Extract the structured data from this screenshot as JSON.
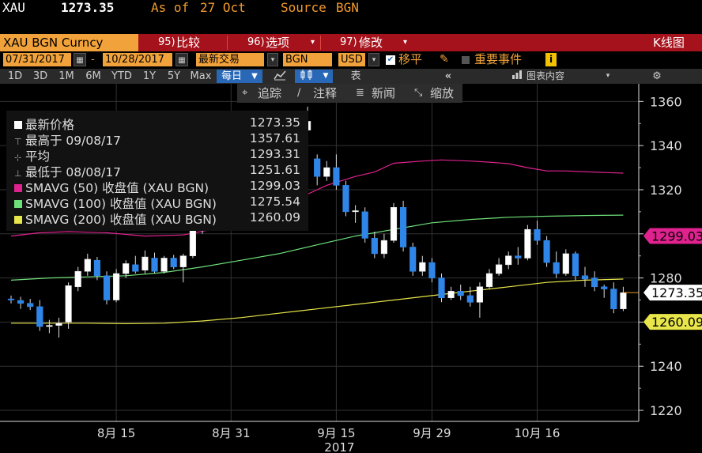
{
  "header": {
    "ticker": "XAU",
    "price": "1273.35",
    "asof_label": "As of",
    "asof_date": "27 Oct",
    "source_label": "Source",
    "source_value": "BGN"
  },
  "toolbar1": {
    "security": "XAU BGN Curncy",
    "compare_num": "95)",
    "compare": "比较",
    "options_num": "96)",
    "options": "选项",
    "edit_num": "97)",
    "edit": "修改",
    "kchart": "K线图"
  },
  "toolbar2": {
    "start_date": "07/31/2017",
    "dash": "-",
    "end_date": "10/28/2017",
    "field": "最新交易",
    "source": "BGN",
    "currency": "USD",
    "move_label": "移平",
    "events_label": "重要事件",
    "info_icon": "i"
  },
  "timeframes": [
    "1D",
    "3D",
    "1M",
    "6M",
    "YTD",
    "1Y",
    "5Y",
    "Max"
  ],
  "toolbar3": {
    "period": "每日",
    "table_label": "表",
    "chart_content": "图表内容"
  },
  "toolbar4": {
    "track": "追踪",
    "annotate": "注释",
    "news": "新闻",
    "zoom": "缩放"
  },
  "legend": {
    "last": {
      "label": "最新价格",
      "value": "1273.35"
    },
    "high": {
      "label": "最高于 09/08/17",
      "value": "1357.61"
    },
    "avg": {
      "label": "平均",
      "value": "1293.31"
    },
    "low": {
      "label": "最低于 08/08/17",
      "value": "1251.61"
    },
    "sma50": {
      "label": "SMAVG (50) 收盘值 (XAU BGN)",
      "value": "1299.03"
    },
    "sma100": {
      "label": "SMAVG (100) 收盘值 (XAU BGN)",
      "value": "1275.54"
    },
    "sma200": {
      "label": "SMAVG (200) 收盘值 (XAU BGN)",
      "value": "1260.09"
    }
  },
  "colors": {
    "up_candle": "#ffffff",
    "down_candle": "#2f86e8",
    "sma50": "#e0228f",
    "sma100": "#6ee07a",
    "sma200": "#e8e64a",
    "last_tag": "#ffffff",
    "toolbar_red": "#a6121b",
    "accent_orange": "#f39a2b"
  },
  "chart_data": {
    "type": "candlestick",
    "ylim": [
      1215,
      1368
    ],
    "yticks": [
      1220,
      1240,
      1260,
      1280,
      1300,
      1320,
      1340,
      1360
    ],
    "xtick_labels": [
      {
        "label": "8月 15",
        "index": 11
      },
      {
        "label": "8月 31",
        "index": 23
      },
      {
        "label": "9月 15",
        "index": 34
      },
      {
        "label": "9月 29",
        "index": 44
      },
      {
        "label": "10月 16",
        "index": 55
      }
    ],
    "year_label": "2017",
    "price_tags": [
      {
        "value": 1299.03,
        "series": "sma50"
      },
      {
        "value": 1273.35,
        "series": "last"
      },
      {
        "value": 1260.09,
        "series": "sma200"
      }
    ],
    "candles": [
      {
        "o": 1270.5,
        "h": 1272.0,
        "l": 1268.5,
        "c": 1270.0
      },
      {
        "o": 1269.8,
        "h": 1271.5,
        "l": 1266.0,
        "c": 1268.5
      },
      {
        "o": 1268.5,
        "h": 1270.5,
        "l": 1265.5,
        "c": 1267.0
      },
      {
        "o": 1267.0,
        "h": 1270.0,
        "l": 1256.0,
        "c": 1258.0
      },
      {
        "o": 1258.0,
        "h": 1261.0,
        "l": 1255.0,
        "c": 1258.5
      },
      {
        "o": 1258.5,
        "h": 1262.0,
        "l": 1253.0,
        "c": 1259.5
      },
      {
        "o": 1260.0,
        "h": 1278.0,
        "l": 1257.0,
        "c": 1276.5
      },
      {
        "o": 1276.0,
        "h": 1285.0,
        "l": 1274.0,
        "c": 1283.0
      },
      {
        "o": 1283.0,
        "h": 1291.0,
        "l": 1281.0,
        "c": 1288.5
      },
      {
        "o": 1288.0,
        "h": 1289.5,
        "l": 1279.0,
        "c": 1281.0
      },
      {
        "o": 1281.0,
        "h": 1283.0,
        "l": 1268.0,
        "c": 1270.0
      },
      {
        "o": 1270.0,
        "h": 1284.0,
        "l": 1269.0,
        "c": 1282.0
      },
      {
        "o": 1282.0,
        "h": 1288.0,
        "l": 1280.0,
        "c": 1286.5
      },
      {
        "o": 1286.0,
        "h": 1290.0,
        "l": 1282.0,
        "c": 1283.0
      },
      {
        "o": 1283.5,
        "h": 1292.5,
        "l": 1282.0,
        "c": 1289.5
      },
      {
        "o": 1289.0,
        "h": 1291.5,
        "l": 1282.0,
        "c": 1283.0
      },
      {
        "o": 1283.0,
        "h": 1290.0,
        "l": 1282.0,
        "c": 1289.0
      },
      {
        "o": 1289.0,
        "h": 1290.5,
        "l": 1284.0,
        "c": 1285.0
      },
      {
        "o": 1285.0,
        "h": 1291.0,
        "l": 1278.0,
        "c": 1290.0
      },
      {
        "o": 1290.0,
        "h": 1303.0,
        "l": 1289.0,
        "c": 1302.0
      },
      {
        "o": 1302.0,
        "h": 1310.0,
        "l": 1300.0,
        "c": 1308.0
      },
      {
        "o": 1308.0,
        "h": 1321.0,
        "l": 1306.0,
        "c": 1319.0
      },
      {
        "o": 1319.0,
        "h": 1322.0,
        "l": 1310.0,
        "c": 1312.0
      },
      {
        "o": 1312.0,
        "h": 1318.0,
        "l": 1305.0,
        "c": 1315.0
      },
      {
        "o": 1315.0,
        "h": 1327.0,
        "l": 1314.0,
        "c": 1325.0
      },
      {
        "o": 1325.0,
        "h": 1329.0,
        "l": 1320.0,
        "c": 1327.0
      },
      {
        "o": 1327.0,
        "h": 1332.0,
        "l": 1325.0,
        "c": 1330.0
      },
      {
        "o": 1330.0,
        "h": 1336.0,
        "l": 1327.0,
        "c": 1334.0
      },
      {
        "o": 1334.0,
        "h": 1338.0,
        "l": 1330.0,
        "c": 1332.0
      },
      {
        "o": 1332.0,
        "h": 1350.0,
        "l": 1331.0,
        "c": 1348.0
      },
      {
        "o": 1348.0,
        "h": 1352.0,
        "l": 1344.0,
        "c": 1347.0
      },
      {
        "o": 1347.0,
        "h": 1357.61,
        "l": 1345.0,
        "c": 1351.0
      },
      {
        "o": 1334.0,
        "h": 1336.0,
        "l": 1322.0,
        "c": 1326.0
      },
      {
        "o": 1326.0,
        "h": 1333.0,
        "l": 1324.0,
        "c": 1330.0
      },
      {
        "o": 1330.0,
        "h": 1336.0,
        "l": 1320.0,
        "c": 1322.0
      },
      {
        "o": 1322.0,
        "h": 1324.0,
        "l": 1308.0,
        "c": 1310.0
      },
      {
        "o": 1310.0,
        "h": 1313.0,
        "l": 1305.0,
        "c": 1310.5
      },
      {
        "o": 1310.0,
        "h": 1312.0,
        "l": 1296.0,
        "c": 1298.0
      },
      {
        "o": 1298.0,
        "h": 1301.0,
        "l": 1289.0,
        "c": 1291.0
      },
      {
        "o": 1291.0,
        "h": 1300.0,
        "l": 1289.0,
        "c": 1297.0
      },
      {
        "o": 1297.0,
        "h": 1314.0,
        "l": 1296.0,
        "c": 1312.0
      },
      {
        "o": 1312.0,
        "h": 1315.0,
        "l": 1292.0,
        "c": 1294.0
      },
      {
        "o": 1294.0,
        "h": 1296.0,
        "l": 1281.0,
        "c": 1283.0
      },
      {
        "o": 1283.0,
        "h": 1290.0,
        "l": 1281.0,
        "c": 1287.0
      },
      {
        "o": 1287.0,
        "h": 1289.0,
        "l": 1278.0,
        "c": 1280.0
      },
      {
        "o": 1280.0,
        "h": 1282.0,
        "l": 1269.0,
        "c": 1271.0
      },
      {
        "o": 1271.0,
        "h": 1276.0,
        "l": 1270.0,
        "c": 1274.0
      },
      {
        "o": 1274.0,
        "h": 1277.0,
        "l": 1270.0,
        "c": 1272.0
      },
      {
        "o": 1272.0,
        "h": 1276.0,
        "l": 1267.0,
        "c": 1269.0
      },
      {
        "o": 1269.0,
        "h": 1278.0,
        "l": 1262.0,
        "c": 1276.0
      },
      {
        "o": 1276.0,
        "h": 1284.0,
        "l": 1275.0,
        "c": 1282.0
      },
      {
        "o": 1282.0,
        "h": 1289.0,
        "l": 1281.0,
        "c": 1286.0
      },
      {
        "o": 1286.0,
        "h": 1292.0,
        "l": 1284.0,
        "c": 1290.0
      },
      {
        "o": 1290.0,
        "h": 1294.0,
        "l": 1286.0,
        "c": 1289.0
      },
      {
        "o": 1289.0,
        "h": 1304.0,
        "l": 1288.0,
        "c": 1302.0
      },
      {
        "o": 1302.0,
        "h": 1306.0,
        "l": 1295.0,
        "c": 1297.0
      },
      {
        "o": 1297.0,
        "h": 1299.0,
        "l": 1285.0,
        "c": 1287.0
      },
      {
        "o": 1287.0,
        "h": 1292.0,
        "l": 1280.0,
        "c": 1282.0
      },
      {
        "o": 1282.0,
        "h": 1293.0,
        "l": 1281.0,
        "c": 1291.0
      },
      {
        "o": 1291.0,
        "h": 1292.0,
        "l": 1279.0,
        "c": 1281.0
      },
      {
        "o": 1281.0,
        "h": 1285.0,
        "l": 1276.0,
        "c": 1279.5
      },
      {
        "o": 1280.0,
        "h": 1283.0,
        "l": 1274.0,
        "c": 1276.0
      },
      {
        "o": 1276.0,
        "h": 1277.0,
        "l": 1271.0,
        "c": 1275.0
      },
      {
        "o": 1275.0,
        "h": 1278.0,
        "l": 1264.0,
        "c": 1266.0
      },
      {
        "o": 1266.0,
        "h": 1276.0,
        "l": 1265.0,
        "c": 1273.35
      }
    ],
    "sma50": [
      [
        0,
        1299.0
      ],
      [
        3,
        1300.5
      ],
      [
        6,
        1301.0
      ],
      [
        10,
        1300.5
      ],
      [
        14,
        1299.0
      ],
      [
        18,
        1299.5
      ],
      [
        21,
        1302.0
      ],
      [
        24,
        1306.0
      ],
      [
        27,
        1311.0
      ],
      [
        30,
        1316.0
      ],
      [
        33,
        1322.0
      ],
      [
        36,
        1326.0
      ],
      [
        38,
        1328.0
      ],
      [
        40,
        1332.0
      ],
      [
        43,
        1333.0
      ],
      [
        45,
        1333.5
      ],
      [
        48,
        1333.0
      ],
      [
        50,
        1332.5
      ],
      [
        52,
        1331.8
      ],
      [
        54,
        1330.0
      ],
      [
        56,
        1328.5
      ],
      [
        58,
        1328.5
      ],
      [
        62,
        1327.8
      ],
      [
        64,
        1327.5
      ]
    ],
    "sma100": [
      [
        0,
        1279.0
      ],
      [
        4,
        1280.0
      ],
      [
        8,
        1280.5
      ],
      [
        12,
        1281.0
      ],
      [
        16,
        1282.5
      ],
      [
        20,
        1285.0
      ],
      [
        24,
        1288.0
      ],
      [
        28,
        1291.0
      ],
      [
        32,
        1295.0
      ],
      [
        36,
        1299.0
      ],
      [
        40,
        1302.0
      ],
      [
        44,
        1305.0
      ],
      [
        48,
        1306.5
      ],
      [
        52,
        1307.5
      ],
      [
        56,
        1308.0
      ],
      [
        60,
        1308.3
      ],
      [
        64,
        1308.5
      ]
    ],
    "sma200": [
      [
        0,
        1259.5
      ],
      [
        8,
        1259.5
      ],
      [
        12,
        1259.3
      ],
      [
        16,
        1259.5
      ],
      [
        20,
        1260.5
      ],
      [
        24,
        1262.0
      ],
      [
        28,
        1264.0
      ],
      [
        32,
        1266.0
      ],
      [
        36,
        1268.0
      ],
      [
        40,
        1270.0
      ],
      [
        44,
        1272.0
      ],
      [
        48,
        1274.0
      ],
      [
        52,
        1276.0
      ],
      [
        56,
        1278.0
      ],
      [
        60,
        1279.0
      ],
      [
        64,
        1279.5
      ]
    ]
  }
}
